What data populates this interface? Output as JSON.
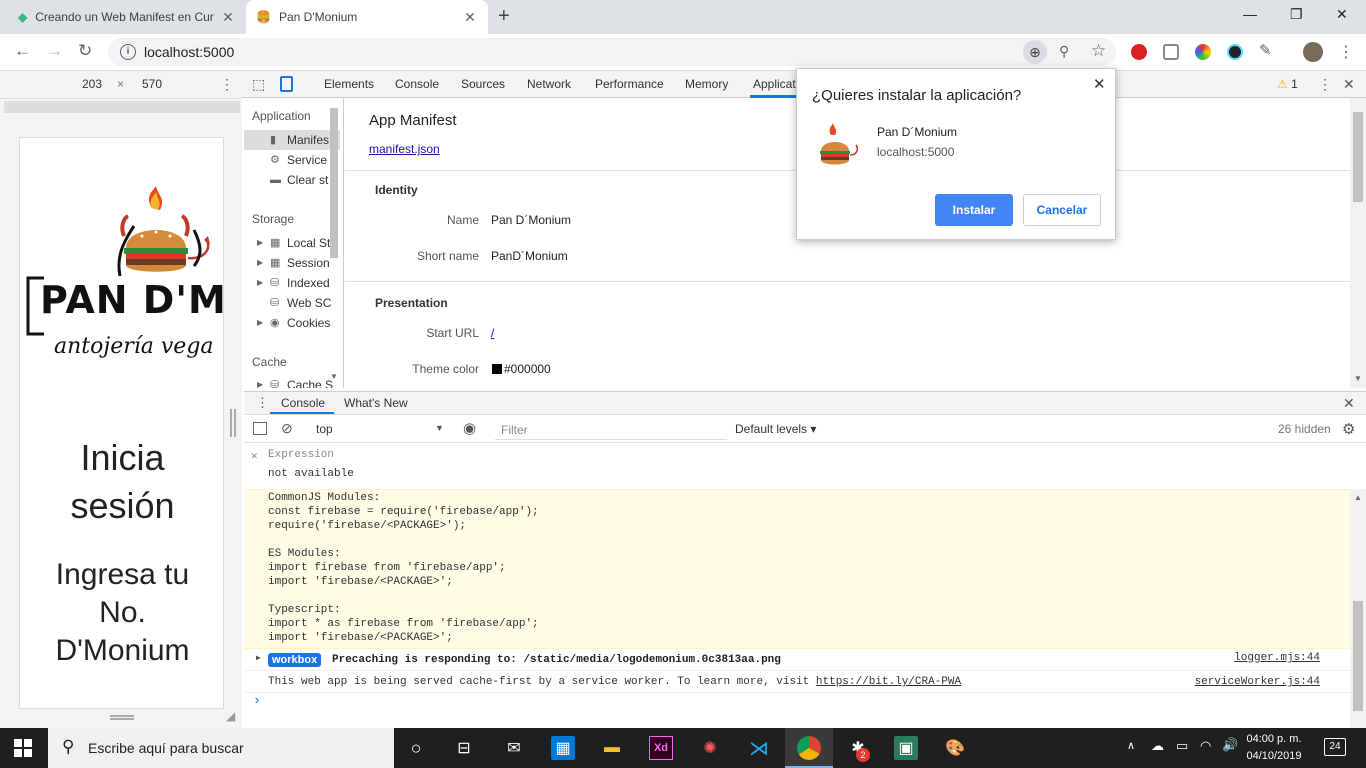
{
  "browser": {
    "tabs": [
      {
        "title": "Creando un Web Manifest en Cur",
        "active": false
      },
      {
        "title": "Pan D'Monium",
        "active": true
      }
    ],
    "address": "localhost:5000"
  },
  "device_toolbar": {
    "width": "203",
    "height": "570",
    "times": "×"
  },
  "device_page": {
    "logo_title": "PAN D'MONI",
    "logo_tagline": "antojería vega",
    "heading": [
      "Inicia",
      "sesión"
    ],
    "subheading": [
      "Ingresa tu",
      "No.",
      "D'Monium"
    ]
  },
  "devtools": {
    "tabs": [
      "Elements",
      "Console",
      "Sources",
      "Network",
      "Performance",
      "Memory",
      "Applicat"
    ],
    "warning_count": "1",
    "sidebar": {
      "application_header": "Application",
      "application_items": [
        "Manifes",
        "Service",
        "Clear st"
      ],
      "storage_header": "Storage",
      "storage_items": [
        "Local St",
        "Session",
        "Indexed",
        "Web SC",
        "Cookies"
      ],
      "cache_header": "Cache",
      "cache_items": [
        "Cache S"
      ]
    },
    "manifest": {
      "title": "App Manifest",
      "link": "manifest.json",
      "identity_header": "Identity",
      "name_label": "Name",
      "name_value": "Pan D´Monium",
      "short_name_label": "Short name",
      "short_name_value": "PanD´Monium",
      "presentation_header": "Presentation",
      "start_url_label": "Start URL",
      "start_url_value": "/",
      "theme_color_label": "Theme color",
      "theme_color_value": "#000000"
    }
  },
  "install_dialog": {
    "title": "¿Quieres instalar la aplicación?",
    "app_name": "Pan D´Monium",
    "origin": "localhost:5000",
    "install_label": "Instalar",
    "cancel_label": "Cancelar"
  },
  "console": {
    "drawer_tabs": [
      "Console",
      "What's New"
    ],
    "context": "top",
    "filter_placeholder": "Filter",
    "levels": "Default levels",
    "hidden": "26 hidden",
    "expression_label": "Expression",
    "expression_value": "not available",
    "warning_lines": [
      "CommonJS Modules:",
      "const firebase = require('firebase/app');",
      "require('firebase/<PACKAGE>');",
      "",
      "ES Modules:",
      "import firebase from 'firebase/app';",
      "import 'firebase/<PACKAGE>';",
      "",
      "Typescript:",
      "import * as firebase from 'firebase/app';",
      "import 'firebase/<PACKAGE>';"
    ],
    "workbox_badge": "workbox",
    "workbox_msg": "Precaching is responding to: /static/media/logodemonium.0c3813aa.png",
    "workbox_src": "logger.mjs:44",
    "sw_msg_prefix": "This web app is being served cache-first by a service worker. To learn more, visit ",
    "sw_link": "https://bit.ly/CRA-PWA",
    "sw_src": "serviceWorker.js:44",
    "prompt": "›"
  },
  "taskbar": {
    "search_placeholder": "Escribe aquí para buscar",
    "time": "04:00 p. m.",
    "date": "04/10/2019",
    "notifications": "24"
  },
  "colors": {
    "chrome_frame": "#dee1e6",
    "devtools_bg": "#f3f3f3",
    "primary_blue": "#4285f4",
    "warning_bg": "#fffbe5",
    "taskbar": "#1f1f1f"
  }
}
